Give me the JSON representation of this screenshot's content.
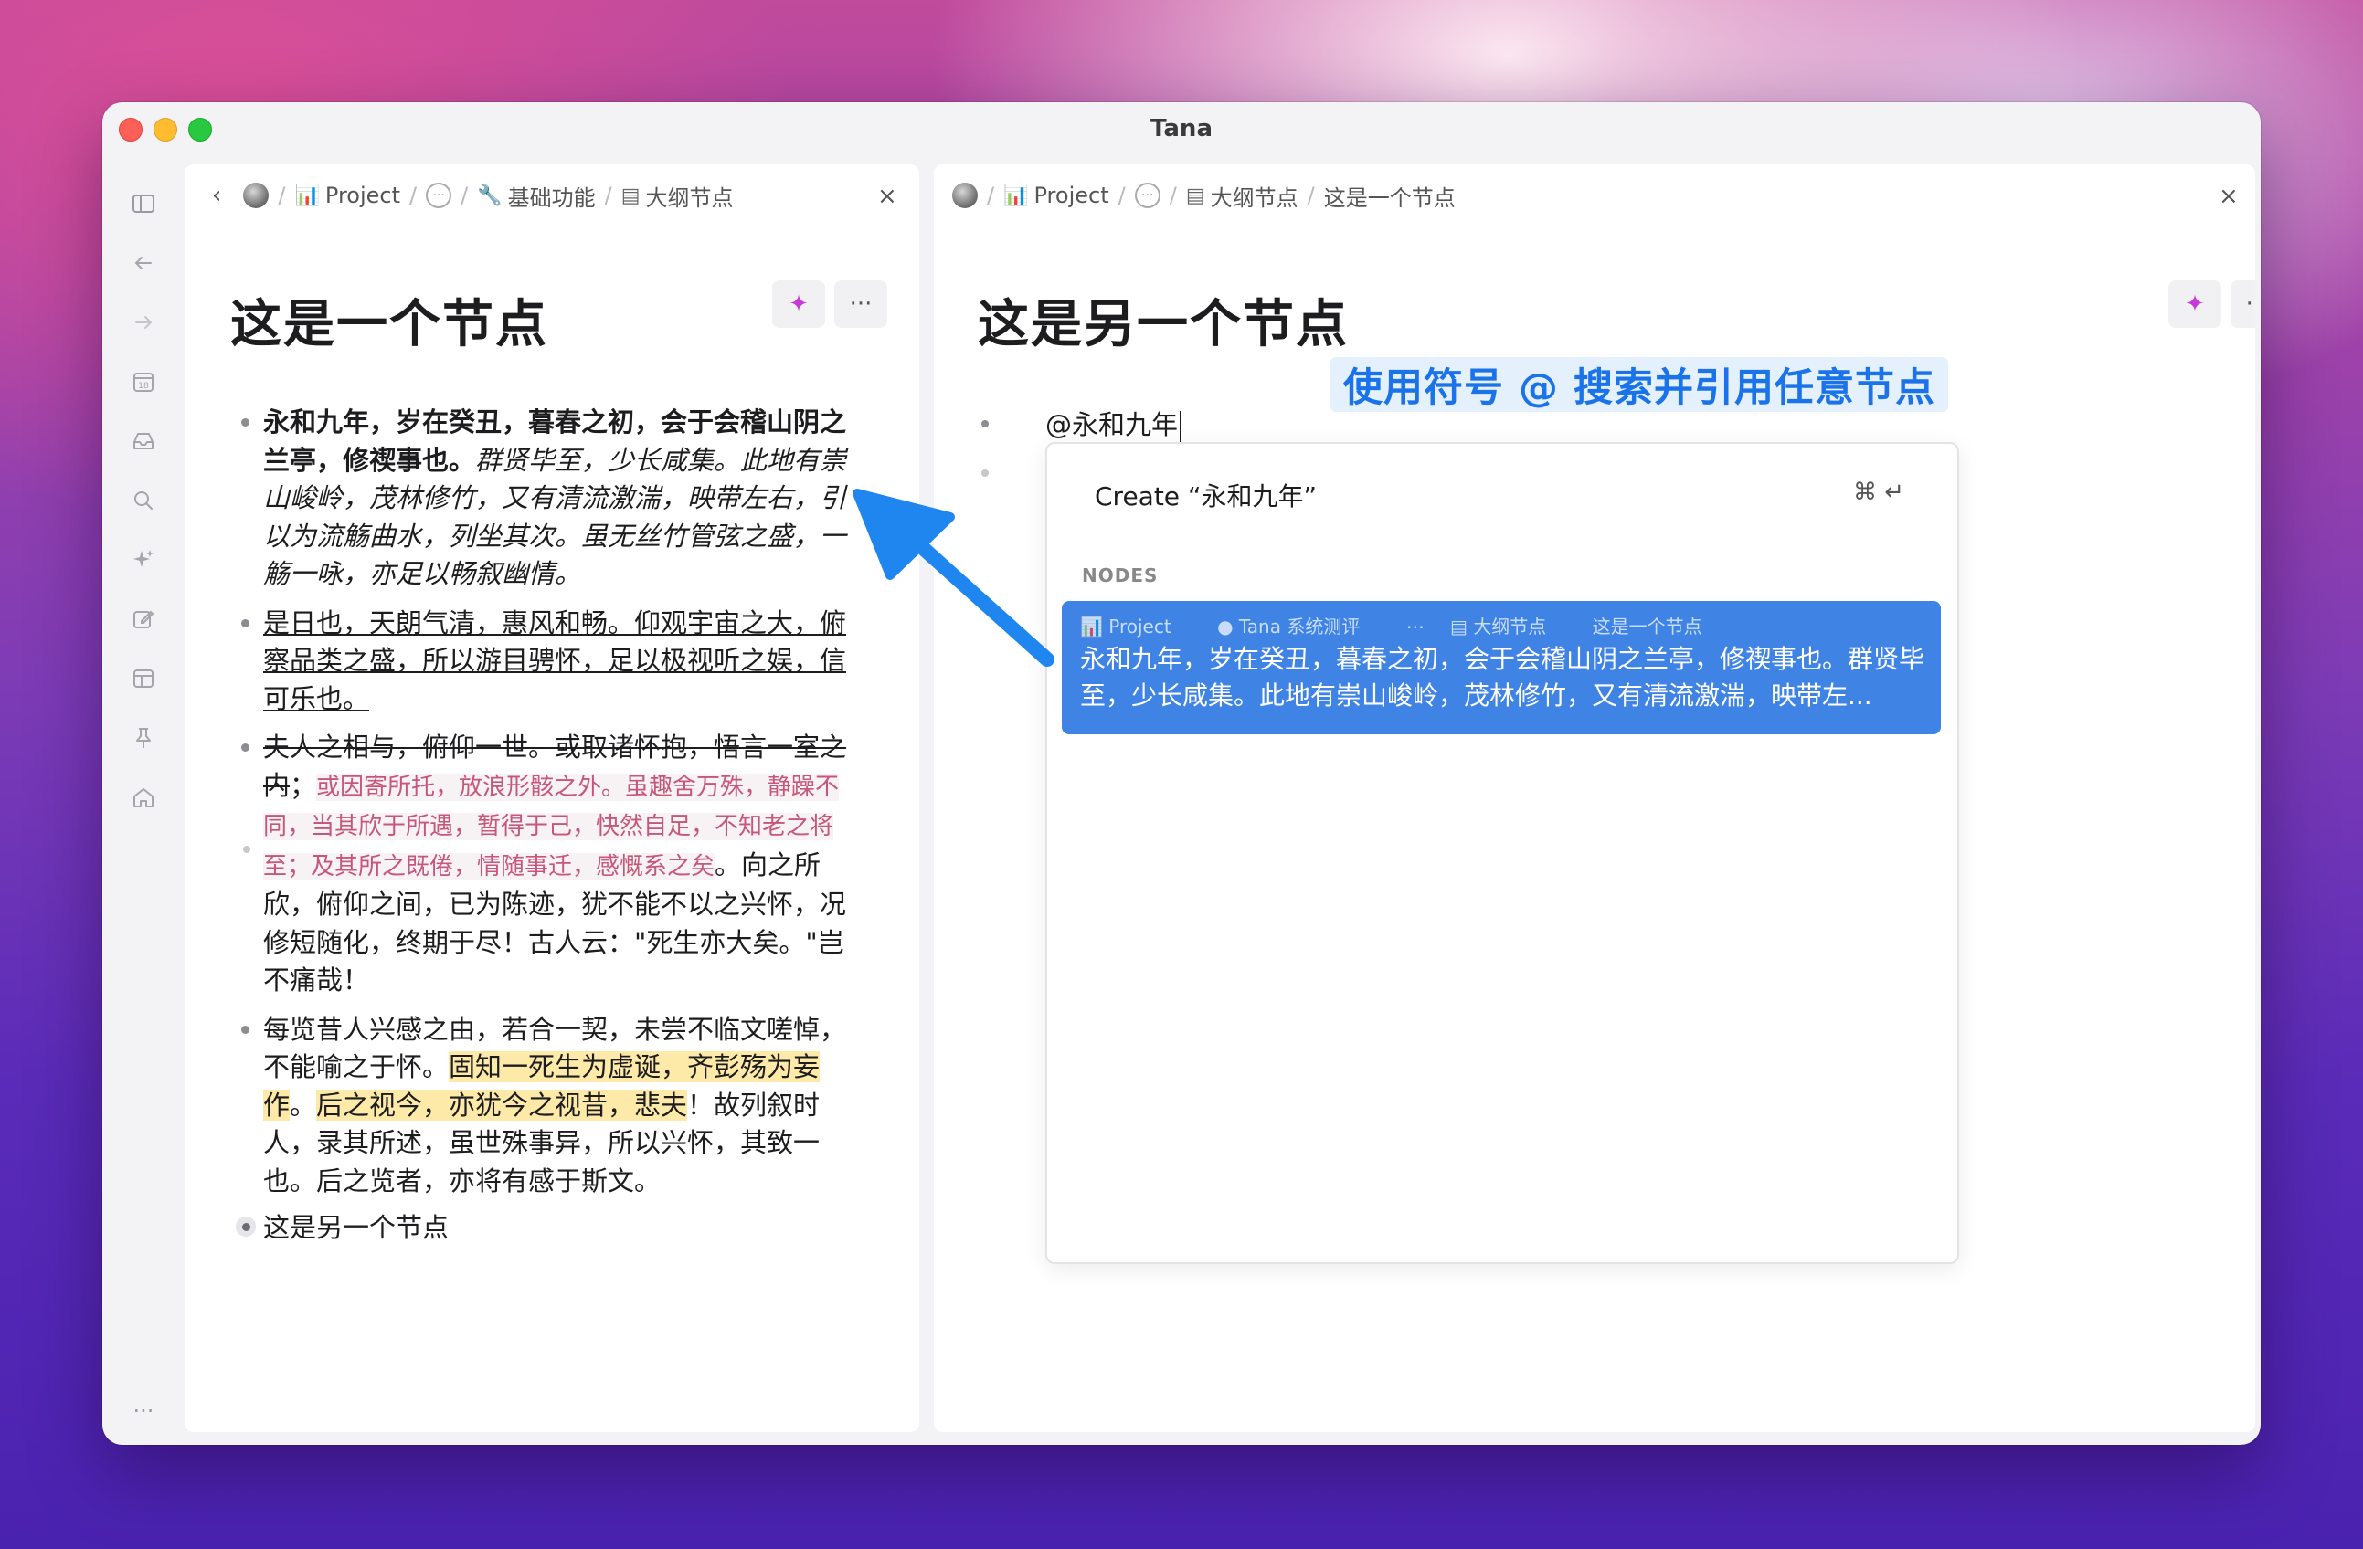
{
  "window": {
    "title": "Tana"
  },
  "left_panel": {
    "breadcrumb": {
      "back": "‹",
      "items": [
        "Project",
        "基础功能",
        "大纲节点"
      ]
    },
    "close": "×",
    "title": "这是一个节点",
    "ai_icon": "✦",
    "more": "···",
    "p1_bold": "永和九年，岁在癸丑，暮春之初，会于会稽山阴之兰亭，修禊事也。",
    "p1_italic": "群贤毕至，少长咸集。此地有崇山峻岭，茂林修竹，又有清流激湍，映带左右，引以为流觞曲水，列坐其次。虽无丝竹管弦之盛，一觞一咏，亦足以畅叙幽情。",
    "p2_underline": "是日也，天朗气清，惠风和畅。仰观宇宙之大，俯察品类之盛，所以游目骋怀，足以极视听之娱，信可乐也。",
    "p3_strike": "夫人之相与，俯仰一世。或取诸怀抱，悟言一室之内",
    "p3_sep": "；",
    "p3_code": "或因寄所托，放浪形骸之外。虽趣舍万殊，静躁不同，当其欣于所遇，暂得于己，快然自足，不知老之将至；及其所之既倦，情随事迁，感慨系之矣",
    "p3_rest": "。向之所欣，俯仰之间，已为陈迹，犹不能不以之兴怀，况修短随化，终期于尽！古人云：\"死生亦大矣。\"岂不痛哉！",
    "p4_a": "每览昔人兴感之由，若合一契，未尝不临文嗟悼，不能喻之于怀。",
    "p4_hl1": "固知一死生为虚诞，齐彭殇为妄作",
    "p4_b": "。",
    "p4_hl2": "后之视今，亦犹今之视昔，悲夫",
    "p4_c": "！故列叙时人，录其所述，虽世殊事异，所以兴怀，其致一也。后之览者，亦将有感于斯文。",
    "ref_item": "这是另一个节点"
  },
  "right_panel": {
    "breadcrumb": {
      "items": [
        "Project",
        "大纲节点",
        "这是一个节点"
      ]
    },
    "close": "×",
    "title": "这是另一个节点",
    "ai_icon": "✦",
    "more": "···",
    "input_value": "@永和九年",
    "annotation": "使用符号 @ 搜索并引用任意节点",
    "popup": {
      "create_label": "Create “永和九年”",
      "create_shortcut": "⌘ ↵",
      "section_header": "NODES",
      "result_path": [
        "Project",
        "Tana 系统测评",
        "大纲节点",
        "这是一个节点"
      ],
      "result_text": "永和九年，岁在癸丑，暮春之初，会于会稽山阴之兰亭，修禊事也。群贤毕至，少长咸集。此地有崇山峻岭，茂林修竹，又有清流激湍，映带左..."
    }
  },
  "sidebar": {
    "icons": [
      "sidebar-toggle-icon",
      "back-arrow-icon",
      "forward-arrow-icon",
      "calendar-icon",
      "inbox-icon",
      "search-icon",
      "ai-sparkle-icon",
      "edit-icon",
      "layout-icon",
      "pin-icon",
      "home-icon",
      "more-icon"
    ],
    "calendar_day": "18",
    "more": "···"
  },
  "colors": {
    "accent_blue": "#1a73e8",
    "selection_blue": "#3f84e5",
    "highlight_yellow": "#fde9a8",
    "code_pink": "#c7577a"
  }
}
